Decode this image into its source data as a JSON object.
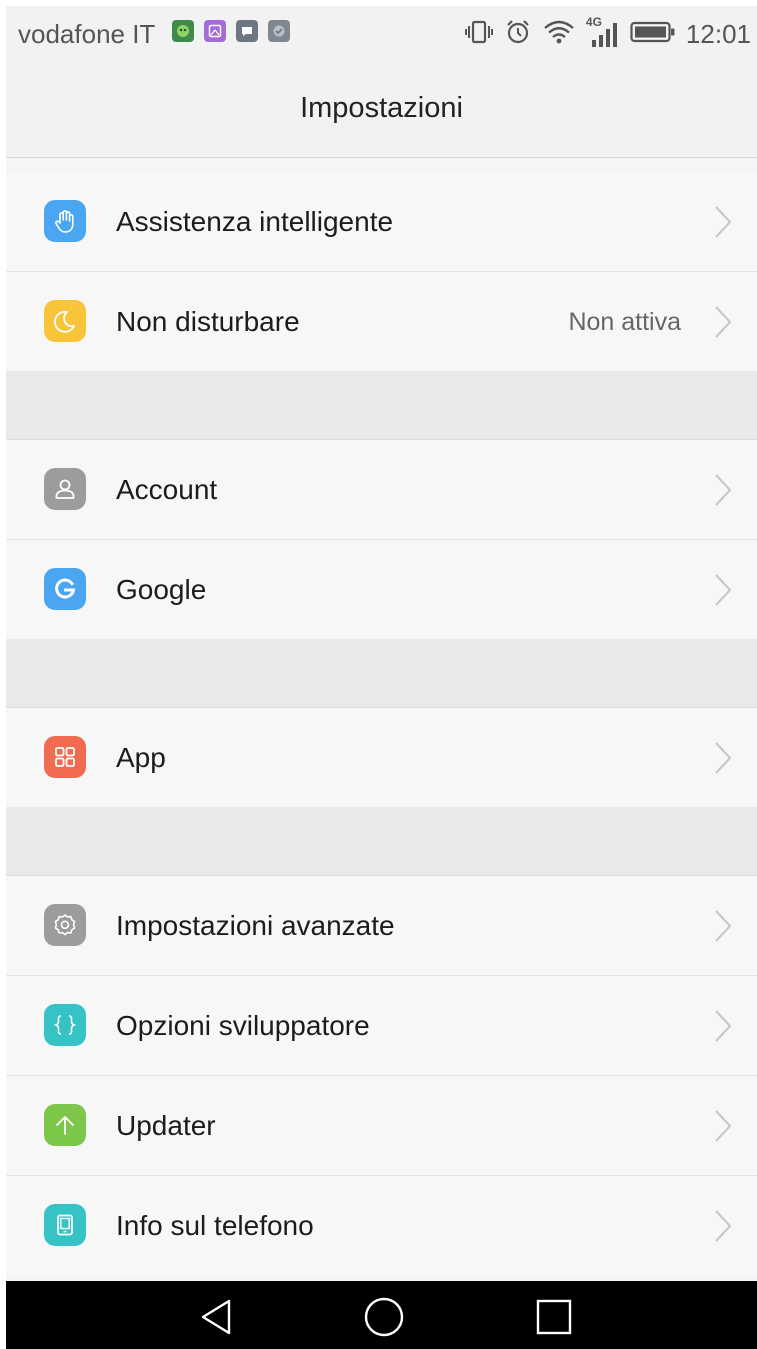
{
  "status_bar": {
    "carrier": "vodafone IT",
    "network": "4G",
    "time": "12:01",
    "notification_icons": [
      "app-notification-icon",
      "gallery-notification-icon",
      "message-notification-icon",
      "shield-notification-icon"
    ],
    "status_icons": [
      "vibrate-icon",
      "alarm-icon",
      "wifi-icon",
      "signal-icon",
      "battery-icon"
    ]
  },
  "header": {
    "title": "Impostazioni"
  },
  "settings": {
    "items": [
      {
        "label": "Assistenza intelligente",
        "icon": "hand-icon",
        "color": "#4aa6f0"
      },
      {
        "label": "Non disturbare",
        "value": "Non attiva",
        "icon": "moon-icon",
        "color": "#f8c43a"
      },
      {
        "label": "Account",
        "icon": "person-icon",
        "color": "#9c9c9c"
      },
      {
        "label": "Google",
        "icon": "google-icon",
        "color": "#4aa6f0"
      },
      {
        "label": "App",
        "icon": "apps-grid-icon",
        "color": "#f26b50"
      },
      {
        "label": "Impostazioni avanzate",
        "icon": "gear-icon",
        "color": "#9c9c9c"
      },
      {
        "label": "Opzioni sviluppatore",
        "icon": "braces-icon",
        "color": "#36c3c6"
      },
      {
        "label": "Updater",
        "icon": "arrow-up-icon",
        "color": "#7cc64a"
      },
      {
        "label": "Info sul telefono",
        "icon": "phone-icon",
        "color": "#36c3c6"
      }
    ]
  },
  "nav_bar": {
    "buttons": [
      "back-icon",
      "home-icon",
      "recents-icon"
    ]
  },
  "colors": {
    "background": "#f5f5f5",
    "row": "#f7f7f7",
    "separator": "#e9e9e9",
    "nav_bar": "#000000"
  }
}
